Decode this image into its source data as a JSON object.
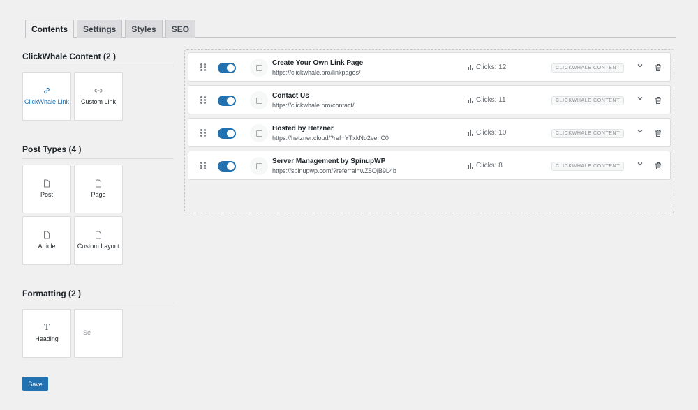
{
  "tabs": [
    {
      "label": "Contents",
      "active": true
    },
    {
      "label": "Settings",
      "active": false
    },
    {
      "label": "Styles",
      "active": false
    },
    {
      "label": "SEO",
      "active": false
    }
  ],
  "sidebar": {
    "sections": [
      {
        "title": "ClickWhale Content (2 )",
        "blocks": [
          {
            "label": "ClickWhale Link",
            "icon": "link-icon"
          },
          {
            "label": "Custom Link",
            "icon": "link-icon"
          }
        ]
      },
      {
        "title": "Post Types (4 )",
        "blocks": [
          {
            "label": "Post",
            "icon": "document-icon"
          },
          {
            "label": "Page",
            "icon": "document-icon"
          },
          {
            "label": "Article",
            "icon": "document-icon"
          },
          {
            "label": "Custom Layout",
            "icon": "document-icon"
          }
        ]
      },
      {
        "title": "Formatting (2 )",
        "blocks": [
          {
            "label": "Heading",
            "icon": "heading-icon"
          },
          {
            "label": "Se",
            "icon": ""
          }
        ]
      }
    ]
  },
  "items": [
    {
      "name": "Create Your Own Link Page",
      "url": "https://clickwhale.pro/linkpages/",
      "clicks": "Clicks: 12",
      "badge": "CLICKWHALE CONTENT"
    },
    {
      "name": "Contact Us",
      "url": "https://clickwhale.pro/contact/",
      "clicks": "Clicks: 11",
      "badge": "CLICKWHALE CONTENT"
    },
    {
      "name": "Hosted by Hetzner",
      "url": "https://hetzner.cloud/?ref=YTxkNo2venC0",
      "clicks": "Clicks: 10",
      "badge": "CLICKWHALE CONTENT"
    },
    {
      "name": "Server Management by SpinupWP",
      "url": "https://spinupwp.com/?referral=wZ5OjB9L4b",
      "clicks": "Clicks: 8",
      "badge": "CLICKWHALE CONTENT"
    }
  ],
  "save_label": "Save",
  "colors": {
    "accent": "#2271b1",
    "background": "#f0f0f1"
  }
}
